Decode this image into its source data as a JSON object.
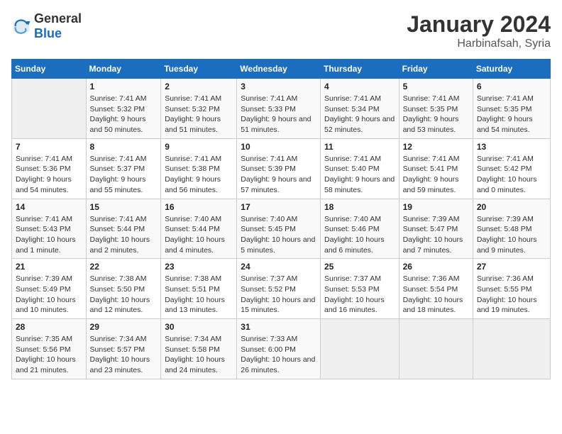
{
  "header": {
    "logo_general": "General",
    "logo_blue": "Blue",
    "title": "January 2024",
    "subtitle": "Harbinafsah, Syria"
  },
  "columns": [
    "Sunday",
    "Monday",
    "Tuesday",
    "Wednesday",
    "Thursday",
    "Friday",
    "Saturday"
  ],
  "weeks": [
    [
      {
        "day": "",
        "sunrise": "",
        "sunset": "",
        "daylight": "",
        "empty": true
      },
      {
        "day": "1",
        "sunrise": "Sunrise: 7:41 AM",
        "sunset": "Sunset: 5:32 PM",
        "daylight": "Daylight: 9 hours and 50 minutes."
      },
      {
        "day": "2",
        "sunrise": "Sunrise: 7:41 AM",
        "sunset": "Sunset: 5:32 PM",
        "daylight": "Daylight: 9 hours and 51 minutes."
      },
      {
        "day": "3",
        "sunrise": "Sunrise: 7:41 AM",
        "sunset": "Sunset: 5:33 PM",
        "daylight": "Daylight: 9 hours and 51 minutes."
      },
      {
        "day": "4",
        "sunrise": "Sunrise: 7:41 AM",
        "sunset": "Sunset: 5:34 PM",
        "daylight": "Daylight: 9 hours and 52 minutes."
      },
      {
        "day": "5",
        "sunrise": "Sunrise: 7:41 AM",
        "sunset": "Sunset: 5:35 PM",
        "daylight": "Daylight: 9 hours and 53 minutes."
      },
      {
        "day": "6",
        "sunrise": "Sunrise: 7:41 AM",
        "sunset": "Sunset: 5:35 PM",
        "daylight": "Daylight: 9 hours and 54 minutes."
      }
    ],
    [
      {
        "day": "7",
        "sunrise": "Sunrise: 7:41 AM",
        "sunset": "Sunset: 5:36 PM",
        "daylight": "Daylight: 9 hours and 54 minutes."
      },
      {
        "day": "8",
        "sunrise": "Sunrise: 7:41 AM",
        "sunset": "Sunset: 5:37 PM",
        "daylight": "Daylight: 9 hours and 55 minutes."
      },
      {
        "day": "9",
        "sunrise": "Sunrise: 7:41 AM",
        "sunset": "Sunset: 5:38 PM",
        "daylight": "Daylight: 9 hours and 56 minutes."
      },
      {
        "day": "10",
        "sunrise": "Sunrise: 7:41 AM",
        "sunset": "Sunset: 5:39 PM",
        "daylight": "Daylight: 9 hours and 57 minutes."
      },
      {
        "day": "11",
        "sunrise": "Sunrise: 7:41 AM",
        "sunset": "Sunset: 5:40 PM",
        "daylight": "Daylight: 9 hours and 58 minutes."
      },
      {
        "day": "12",
        "sunrise": "Sunrise: 7:41 AM",
        "sunset": "Sunset: 5:41 PM",
        "daylight": "Daylight: 9 hours and 59 minutes."
      },
      {
        "day": "13",
        "sunrise": "Sunrise: 7:41 AM",
        "sunset": "Sunset: 5:42 PM",
        "daylight": "Daylight: 10 hours and 0 minutes."
      }
    ],
    [
      {
        "day": "14",
        "sunrise": "Sunrise: 7:41 AM",
        "sunset": "Sunset: 5:43 PM",
        "daylight": "Daylight: 10 hours and 1 minute."
      },
      {
        "day": "15",
        "sunrise": "Sunrise: 7:41 AM",
        "sunset": "Sunset: 5:44 PM",
        "daylight": "Daylight: 10 hours and 2 minutes."
      },
      {
        "day": "16",
        "sunrise": "Sunrise: 7:40 AM",
        "sunset": "Sunset: 5:44 PM",
        "daylight": "Daylight: 10 hours and 4 minutes."
      },
      {
        "day": "17",
        "sunrise": "Sunrise: 7:40 AM",
        "sunset": "Sunset: 5:45 PM",
        "daylight": "Daylight: 10 hours and 5 minutes."
      },
      {
        "day": "18",
        "sunrise": "Sunrise: 7:40 AM",
        "sunset": "Sunset: 5:46 PM",
        "daylight": "Daylight: 10 hours and 6 minutes."
      },
      {
        "day": "19",
        "sunrise": "Sunrise: 7:39 AM",
        "sunset": "Sunset: 5:47 PM",
        "daylight": "Daylight: 10 hours and 7 minutes."
      },
      {
        "day": "20",
        "sunrise": "Sunrise: 7:39 AM",
        "sunset": "Sunset: 5:48 PM",
        "daylight": "Daylight: 10 hours and 9 minutes."
      }
    ],
    [
      {
        "day": "21",
        "sunrise": "Sunrise: 7:39 AM",
        "sunset": "Sunset: 5:49 PM",
        "daylight": "Daylight: 10 hours and 10 minutes."
      },
      {
        "day": "22",
        "sunrise": "Sunrise: 7:38 AM",
        "sunset": "Sunset: 5:50 PM",
        "daylight": "Daylight: 10 hours and 12 minutes."
      },
      {
        "day": "23",
        "sunrise": "Sunrise: 7:38 AM",
        "sunset": "Sunset: 5:51 PM",
        "daylight": "Daylight: 10 hours and 13 minutes."
      },
      {
        "day": "24",
        "sunrise": "Sunrise: 7:37 AM",
        "sunset": "Sunset: 5:52 PM",
        "daylight": "Daylight: 10 hours and 15 minutes."
      },
      {
        "day": "25",
        "sunrise": "Sunrise: 7:37 AM",
        "sunset": "Sunset: 5:53 PM",
        "daylight": "Daylight: 10 hours and 16 minutes."
      },
      {
        "day": "26",
        "sunrise": "Sunrise: 7:36 AM",
        "sunset": "Sunset: 5:54 PM",
        "daylight": "Daylight: 10 hours and 18 minutes."
      },
      {
        "day": "27",
        "sunrise": "Sunrise: 7:36 AM",
        "sunset": "Sunset: 5:55 PM",
        "daylight": "Daylight: 10 hours and 19 minutes."
      }
    ],
    [
      {
        "day": "28",
        "sunrise": "Sunrise: 7:35 AM",
        "sunset": "Sunset: 5:56 PM",
        "daylight": "Daylight: 10 hours and 21 minutes."
      },
      {
        "day": "29",
        "sunrise": "Sunrise: 7:34 AM",
        "sunset": "Sunset: 5:57 PM",
        "daylight": "Daylight: 10 hours and 23 minutes."
      },
      {
        "day": "30",
        "sunrise": "Sunrise: 7:34 AM",
        "sunset": "Sunset: 5:58 PM",
        "daylight": "Daylight: 10 hours and 24 minutes."
      },
      {
        "day": "31",
        "sunrise": "Sunrise: 7:33 AM",
        "sunset": "Sunset: 6:00 PM",
        "daylight": "Daylight: 10 hours and 26 minutes."
      },
      {
        "day": "",
        "sunrise": "",
        "sunset": "",
        "daylight": "",
        "empty": true
      },
      {
        "day": "",
        "sunrise": "",
        "sunset": "",
        "daylight": "",
        "empty": true
      },
      {
        "day": "",
        "sunrise": "",
        "sunset": "",
        "daylight": "",
        "empty": true
      }
    ]
  ]
}
